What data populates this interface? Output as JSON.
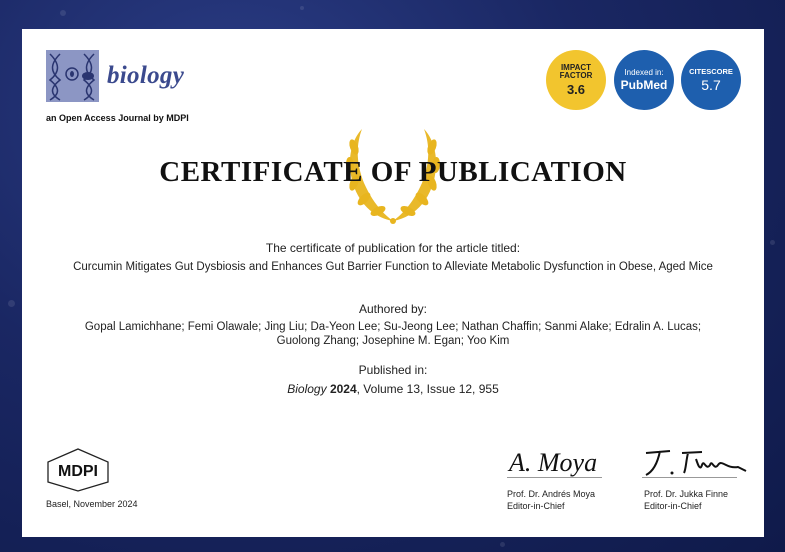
{
  "journal": {
    "name": "biology",
    "tagline": "an Open Access Journal by MDPI"
  },
  "badges": {
    "impact": {
      "label1": "IMPACT",
      "label2": "FACTOR",
      "value": "3.6"
    },
    "pubmed": {
      "label": "Indexed in:",
      "value": "PubMed"
    },
    "citescore": {
      "label": "CITESCORE",
      "value": "5.7"
    }
  },
  "certificate": {
    "title": "CERTIFICATE OF PUBLICATION",
    "intro": "The certificate of publication for the article titled:",
    "article_title": "Curcumin Mitigates Gut Dysbiosis and Enhances Gut Barrier Function to Alleviate Metabolic Dysfunction in Obese, Aged Mice",
    "authored_heading": "Authored by:",
    "authors": "Gopal Lamichhane; Femi Olawale; Jing Liu; Da-Yeon Lee; Su-Jeong Lee; Nathan Chaffin; Sanmi Alake; Edralin A. Lucas; Guolong Zhang; Josephine M. Egan; Yoo Kim",
    "published_heading": "Published in:",
    "journal": "Biology",
    "year": "2024",
    "details": ", Volume 13, Issue 12, 955"
  },
  "footer": {
    "publisher": "MDPI",
    "place_date": "Basel, November 2024",
    "editor1": {
      "signature": "A. Moya",
      "name": "Prof. Dr. Andrés Moya",
      "role": "Editor-in-Chief"
    },
    "editor2": {
      "signature": "J. Finne",
      "name": "Prof. Dr. Jukka Finne",
      "role": "Editor-in-Chief"
    }
  },
  "colors": {
    "background": "#1a2763",
    "impact_badge": "#f2c52e",
    "index_badge": "#1e5fae",
    "laurel": "#e8b51f",
    "journal_name": "#3b4a8e"
  }
}
